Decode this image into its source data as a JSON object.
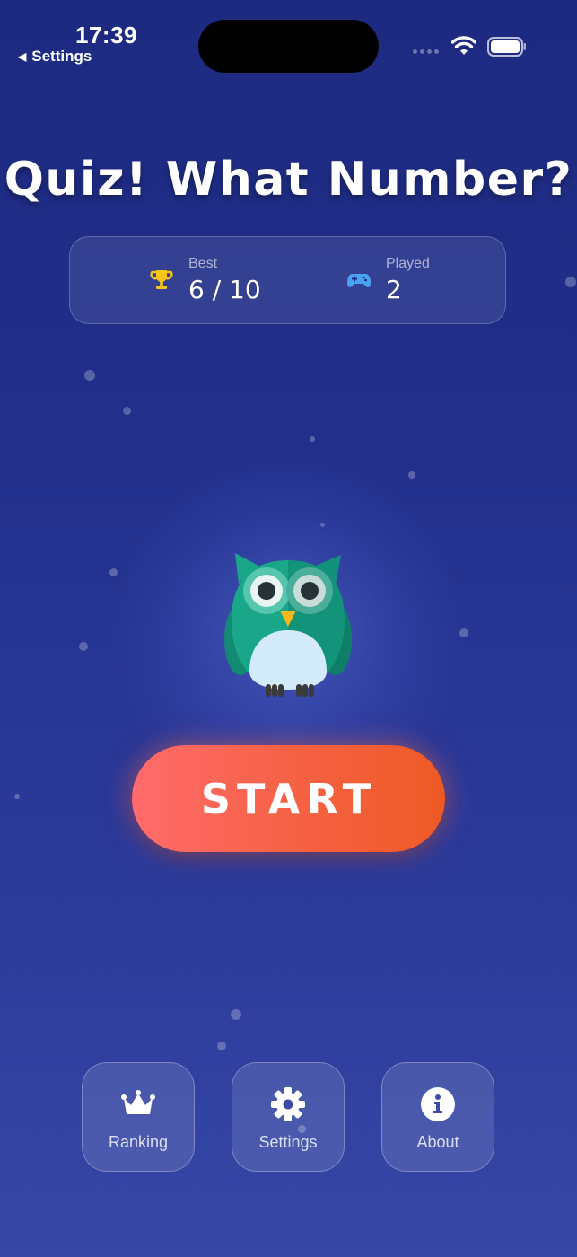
{
  "status_bar": {
    "time": "17:39",
    "back_label": "Settings"
  },
  "title": "Quiz! What Number?",
  "stats": {
    "best": {
      "label": "Best",
      "value": "6 / 10",
      "icon": "trophy-icon",
      "icon_color": "#f7c518"
    },
    "played": {
      "label": "Played",
      "value": "2",
      "icon": "gamepad-icon",
      "icon_color": "#4aa3f0"
    }
  },
  "mascot": {
    "icon": "owl-icon",
    "body_color": "#1aa789"
  },
  "start_button": {
    "label": "START"
  },
  "nav": {
    "ranking": {
      "label": "Ranking",
      "icon": "crown-icon"
    },
    "settings": {
      "label": "Settings",
      "icon": "gear-icon"
    },
    "about": {
      "label": "About",
      "icon": "info-icon"
    }
  },
  "colors": {
    "background_top": "#1d2a80",
    "background_bottom": "#3647a6",
    "start_gradient_from": "#ff6b6b",
    "start_gradient_to": "#ee5a24"
  }
}
